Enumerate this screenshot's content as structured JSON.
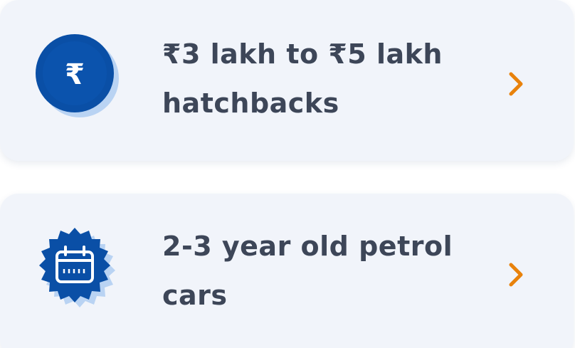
{
  "cards": [
    {
      "title": "₹3 lakh to ₹5 lakh hatchbacks",
      "icon": "rupee-icon",
      "icon_symbol": "₹",
      "action_icon": "chevron-right-icon"
    },
    {
      "title": "2-3 year old petrol cars",
      "icon": "calendar-icon",
      "action_icon": "chevron-right-icon"
    }
  ],
  "colors": {
    "card_background": "#f1f4fa",
    "badge_blue": "#0a4fa6",
    "badge_shadow": "#b9d3f3",
    "title_text": "#3d4658",
    "chevron_orange": "#e8820c"
  }
}
